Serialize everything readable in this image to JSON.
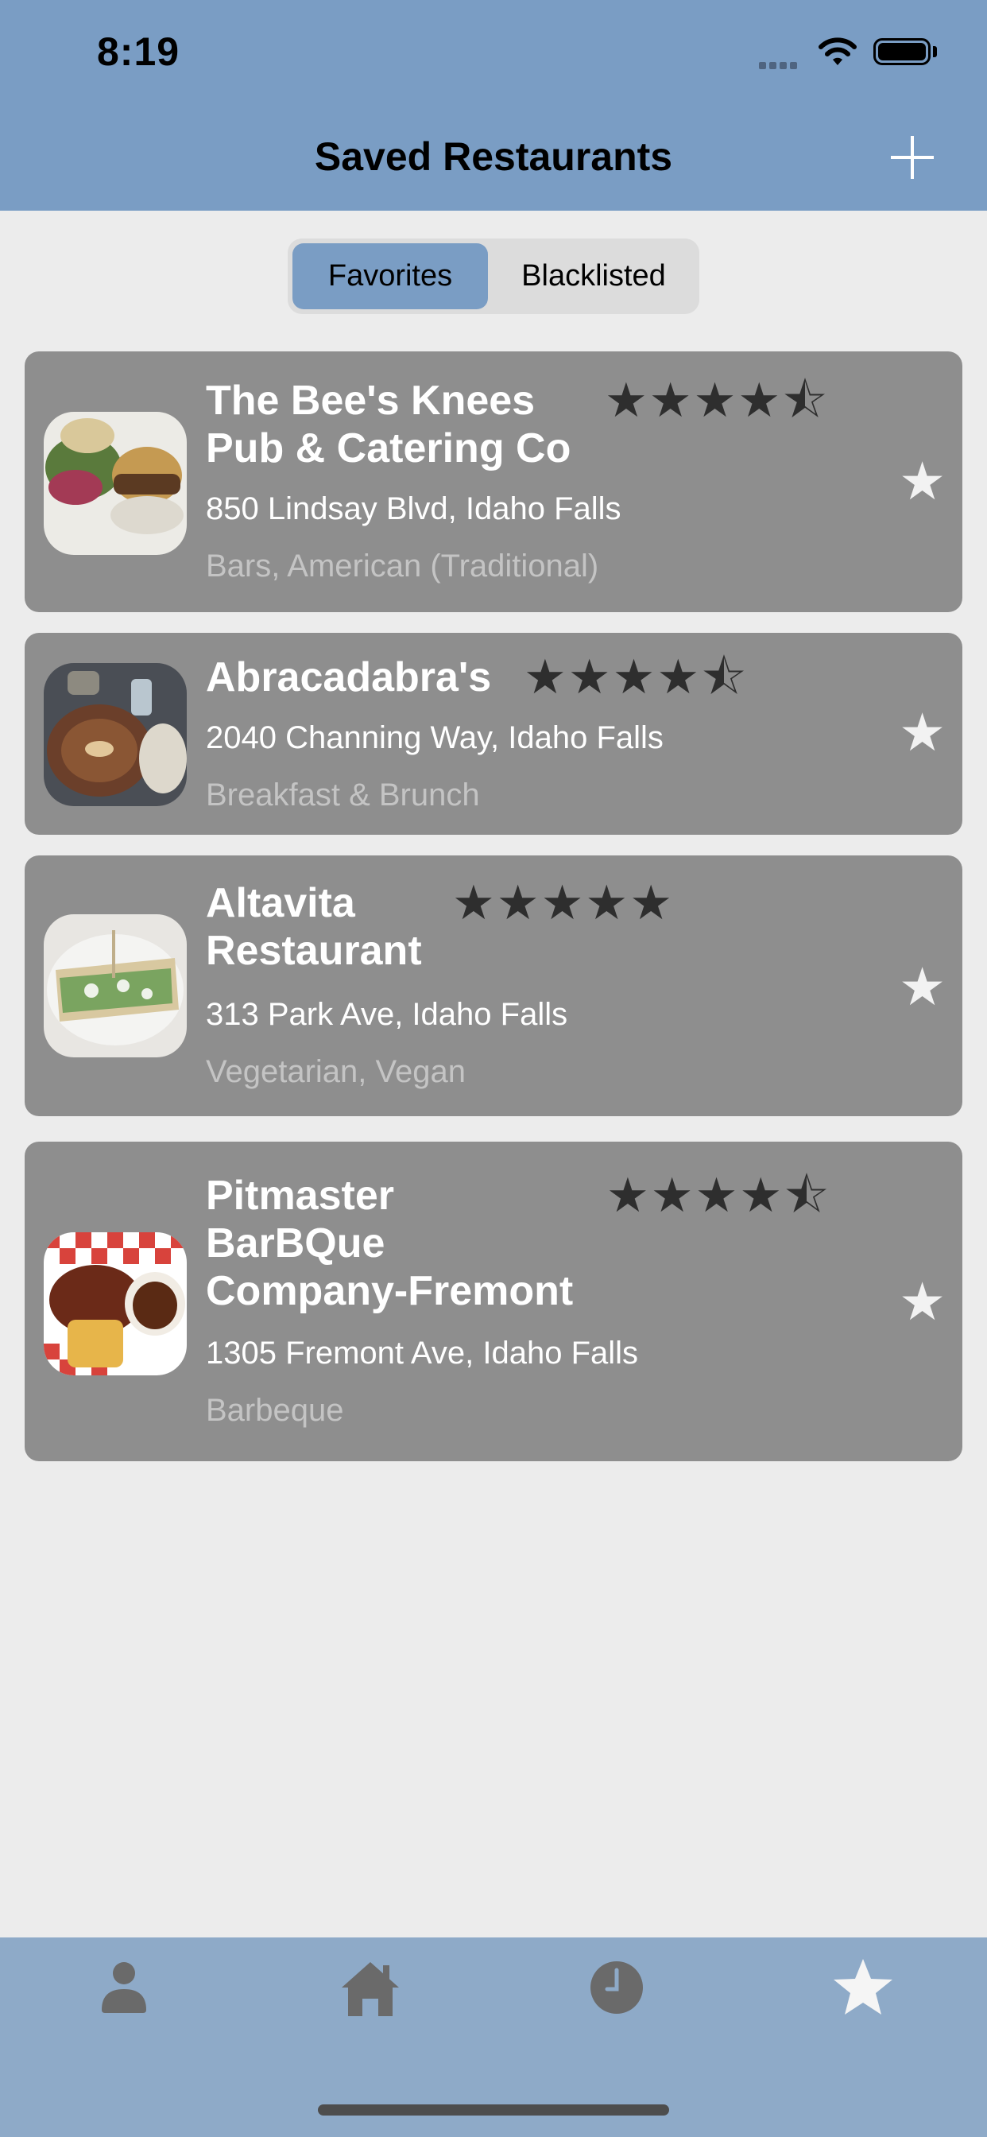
{
  "status_bar": {
    "time": "8:19"
  },
  "nav": {
    "title": "Saved Restaurants",
    "add_icon": "plus-icon"
  },
  "segmented_control": {
    "options": [
      "Favorites",
      "Blacklisted"
    ],
    "selected": "Favorites"
  },
  "restaurants": [
    {
      "name_lines": [
        "The Bee's Knees",
        "Pub & Catering Co"
      ],
      "rating": 4.5,
      "address": "850 Lindsay Blvd, Idaho Falls",
      "categories": "Bars, American (Traditional)",
      "favorite": true
    },
    {
      "name_lines": [
        "Abracadabra's"
      ],
      "rating": 4.5,
      "address": "2040 Channing Way, Idaho Falls",
      "categories": "Breakfast & Brunch",
      "favorite": true
    },
    {
      "name_lines": [
        "Altavita",
        "Restaurant"
      ],
      "rating": 5,
      "address": "313 Park Ave, Idaho Falls",
      "categories": "Vegetarian, Vegan",
      "favorite": true
    },
    {
      "name_lines": [
        "Pitmaster",
        "BarBQue",
        "Company-Fremont"
      ],
      "rating": 4.5,
      "address": "1305 Fremont Ave, Idaho Falls",
      "categories": "Barbeque",
      "favorite": true
    }
  ],
  "tab_bar": {
    "tabs": [
      {
        "icon": "person-icon",
        "active": false
      },
      {
        "icon": "home-icon",
        "active": false
      },
      {
        "icon": "clock-icon",
        "active": false
      },
      {
        "icon": "star-icon",
        "active": true
      }
    ]
  },
  "colors": {
    "accent": "#7a9dc4",
    "card": "#8e8e8e",
    "tab_bar": "#8eaac8"
  }
}
